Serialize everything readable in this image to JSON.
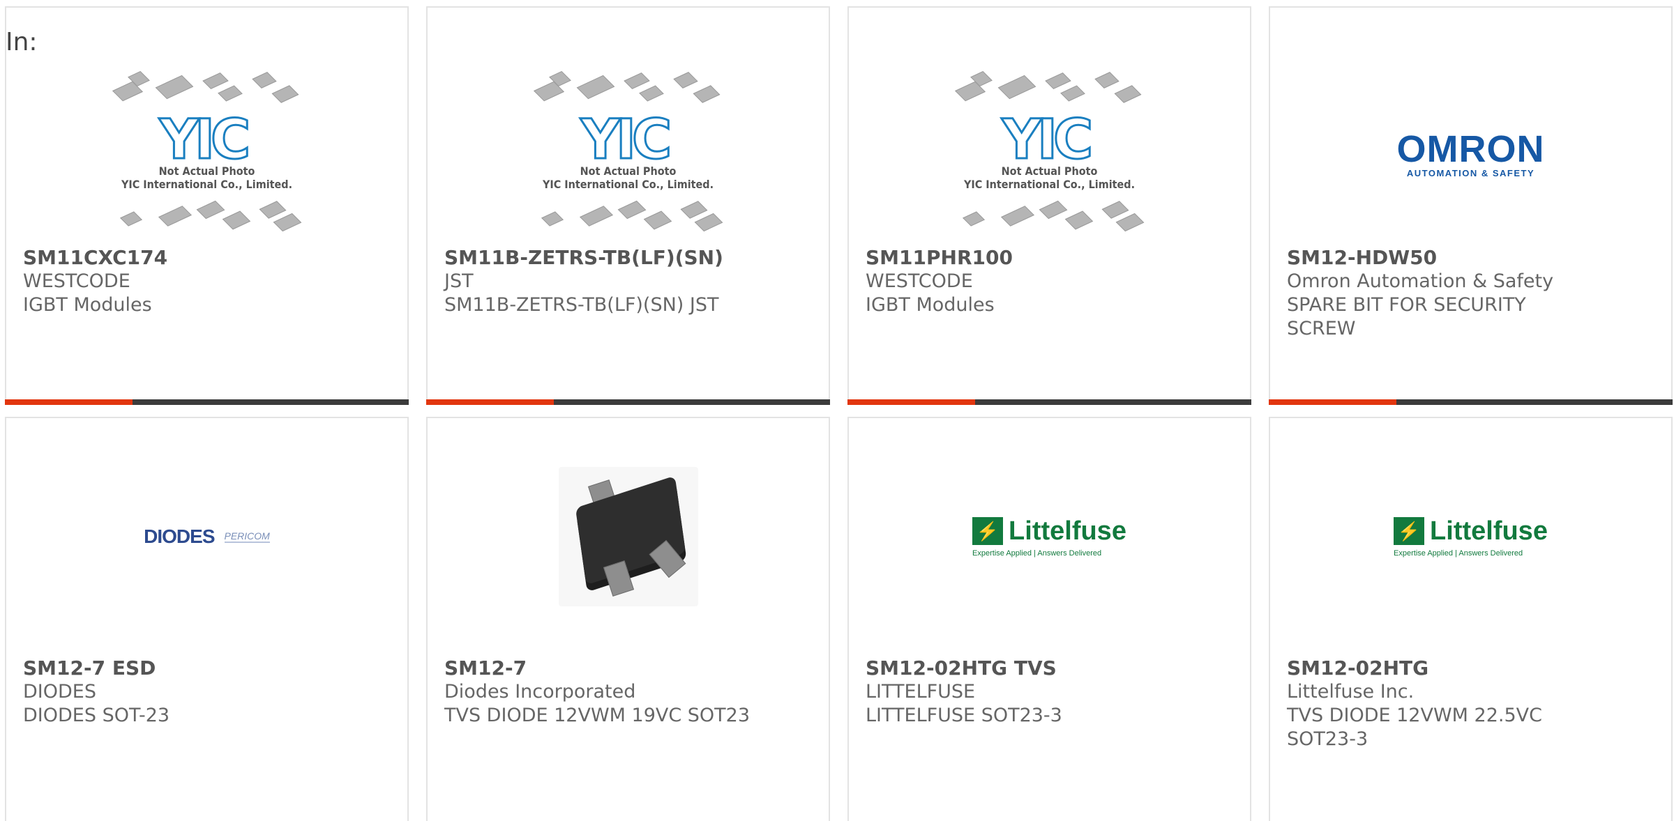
{
  "header": {
    "in_label": "In:"
  },
  "cards": [
    {
      "part": "SM11CXC174",
      "manufacturer": "WESTCODE",
      "description": "IGBT Modules",
      "image": "yic-placeholder",
      "image_note_1": "Not Actual Photo",
      "image_note_2": "YIC International Co., Limited.",
      "logo": "YIC"
    },
    {
      "part": "SM11B-ZETRS-TB(LF)(SN)",
      "manufacturer": "JST",
      "description": "SM11B-ZETRS-TB(LF)(SN) JST",
      "image": "yic-placeholder",
      "image_note_1": "Not Actual Photo",
      "image_note_2": "YIC International Co., Limited.",
      "logo": "YIC"
    },
    {
      "part": "SM11PHR100",
      "manufacturer": "WESTCODE",
      "description": "IGBT Modules",
      "image": "yic-placeholder",
      "image_note_1": "Not Actual Photo",
      "image_note_2": "YIC International Co., Limited.",
      "logo": "YIC"
    },
    {
      "part": "SM12-HDW50",
      "manufacturer": "Omron Automation & Safety",
      "description": "SPARE BIT FOR SECURITY SCREW",
      "image": "omron-logo",
      "logo": "OMRON",
      "logo_sub": "AUTOMATION & SAFETY"
    },
    {
      "part": "SM12-7 ESD",
      "manufacturer": "DIODES",
      "description": "DIODES SOT-23",
      "image": "diodes-logo",
      "logo": "DIODES",
      "logo_sub": "PERICOM"
    },
    {
      "part": "SM12-7",
      "manufacturer": "Diodes Incorporated",
      "description": "TVS DIODE 12VWM 19VC SOT23",
      "image": "sot23-package"
    },
    {
      "part": "SM12-02HTG TVS",
      "manufacturer": "LITTELFUSE",
      "description": "LITTELFUSE SOT23-3",
      "image": "littelfuse-logo",
      "logo": "Littelfuse",
      "logo_sub": "Expertise Applied | Answers Delivered"
    },
    {
      "part": "SM12-02HTG",
      "manufacturer": "Littelfuse Inc.",
      "description": "TVS DIODE 12VWM 22.5VC SOT23-3",
      "image": "littelfuse-logo",
      "logo": "Littelfuse",
      "logo_sub": "Expertise Applied | Answers Delivered"
    }
  ],
  "colors": {
    "accent": "#e2360f",
    "bar": "#3c3c3c",
    "border": "#e3e3e3",
    "text": "#555555"
  }
}
